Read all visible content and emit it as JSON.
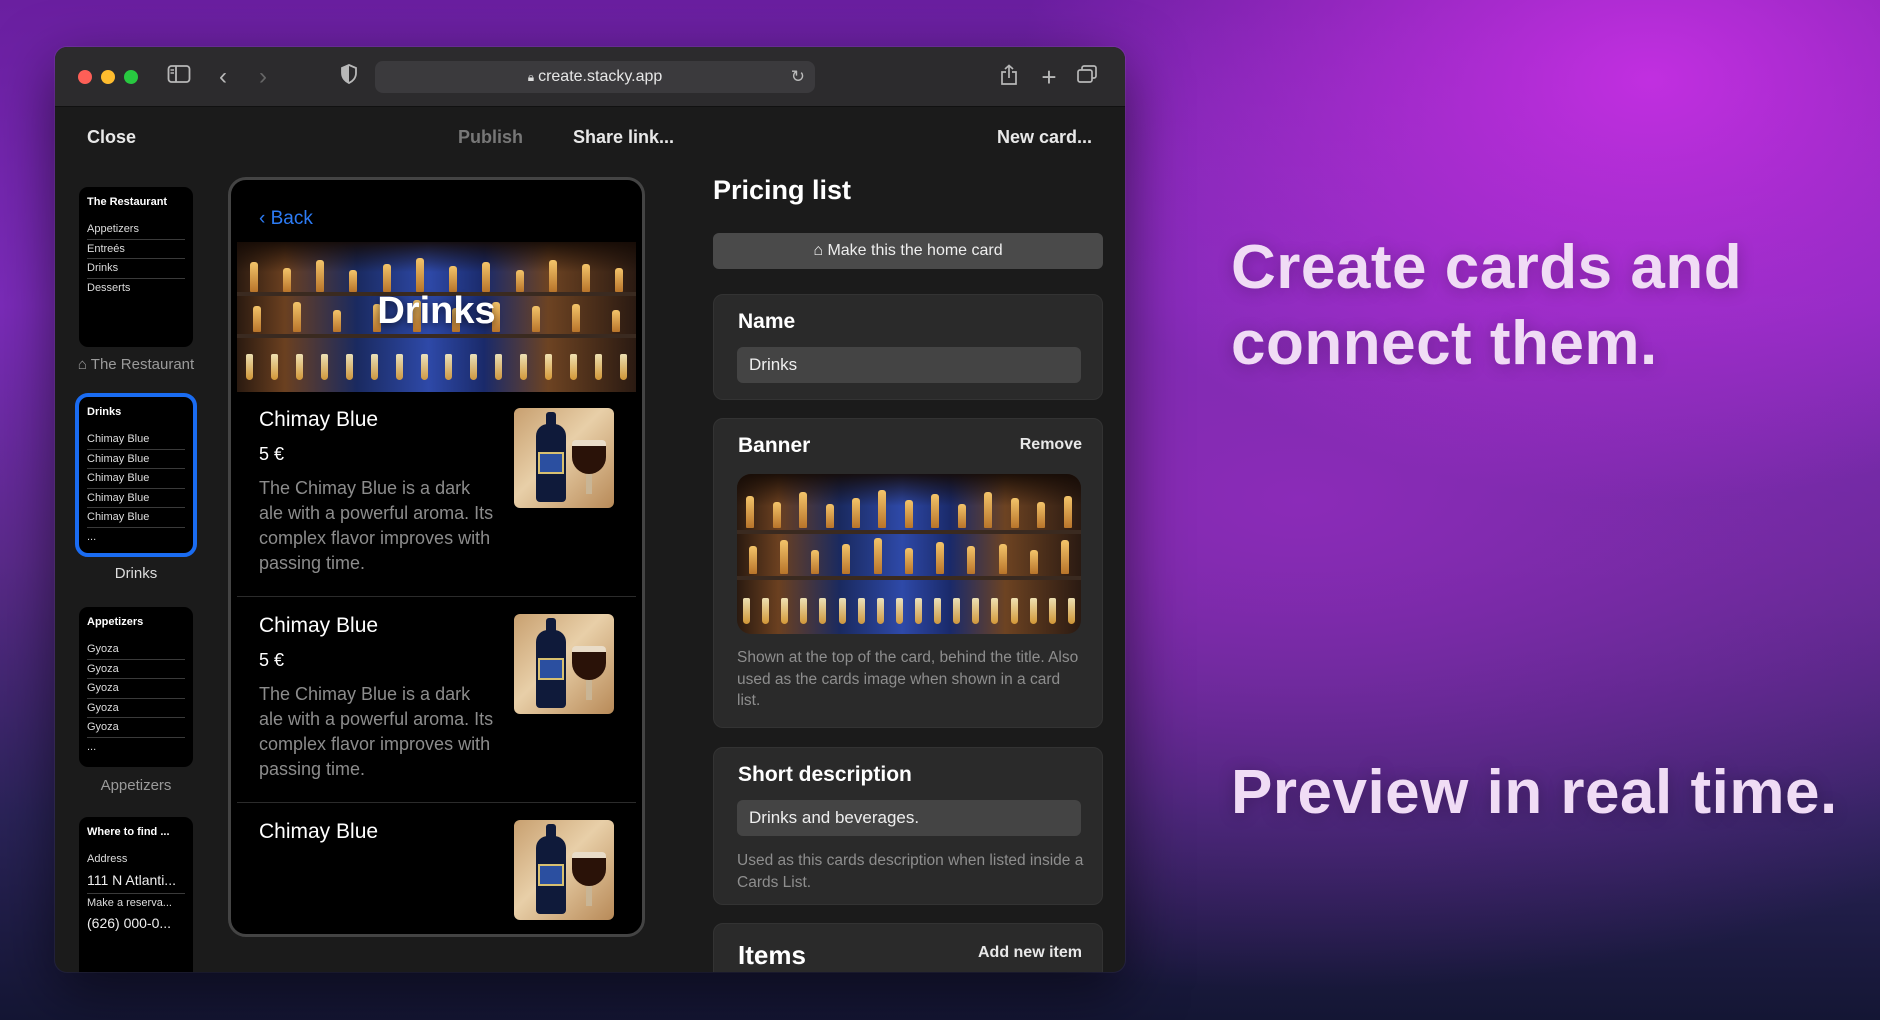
{
  "browser": {
    "url": "create.stacky.app"
  },
  "toolbar": {
    "close": "Close",
    "publish": "Publish",
    "share": "Share link...",
    "new_card": "New card..."
  },
  "sidebar": {
    "cards": [
      {
        "title": "The Restaurant",
        "rows": [
          "Appetizers",
          "Entreés",
          "Drinks",
          "Desserts"
        ],
        "caption_icon": "home-icon",
        "caption": "The Restaurant"
      },
      {
        "title": "Drinks",
        "rows": [
          "Chimay Blue",
          "Chimay Blue",
          "Chimay Blue",
          "Chimay Blue",
          "Chimay Blue",
          "..."
        ],
        "caption": "Drinks",
        "selected": true
      },
      {
        "title": "Appetizers",
        "rows": [
          "Gyoza",
          "Gyoza",
          "Gyoza",
          "Gyoza",
          "Gyoza",
          "..."
        ],
        "caption": "Appetizers"
      },
      {
        "title": "Where to find ...",
        "rows": [
          "Address",
          "111 N Atlanti...",
          "Make a reserva...",
          "(626) 000-0..."
        ]
      }
    ]
  },
  "preview": {
    "back": "Back",
    "banner_title": "Drinks",
    "items": [
      {
        "name": "Chimay Blue",
        "price": "5 €",
        "desc": "The Chimay Blue is a dark ale with a powerful aroma. Its complex flavor improves with passing time."
      },
      {
        "name": "Chimay Blue",
        "price": "5 €",
        "desc": "The Chimay Blue is a dark ale with a powerful aroma. Its complex flavor improves with passing time."
      },
      {
        "name": "Chimay Blue",
        "price": "",
        "desc": ""
      }
    ]
  },
  "panel": {
    "title": "Pricing list",
    "home_button": "Make this the home card",
    "name_label": "Name",
    "name_value": "Drinks",
    "banner_label": "Banner",
    "banner_remove": "Remove",
    "banner_hint": "Shown at the top of the card, behind the title. Also used as the cards image when shown in a card list.",
    "short_desc_label": "Short description",
    "short_desc_value": "Drinks and beverages.",
    "short_desc_hint": "Used as this cards description when listed inside a Cards List.",
    "items_label": "Items",
    "items_action": "Add new item"
  },
  "taglines": {
    "first": "Create cards and connect them.",
    "second": "Preview in real time."
  },
  "colors": {
    "accent": "#1a6cf2",
    "link": "#2d7cf6"
  }
}
